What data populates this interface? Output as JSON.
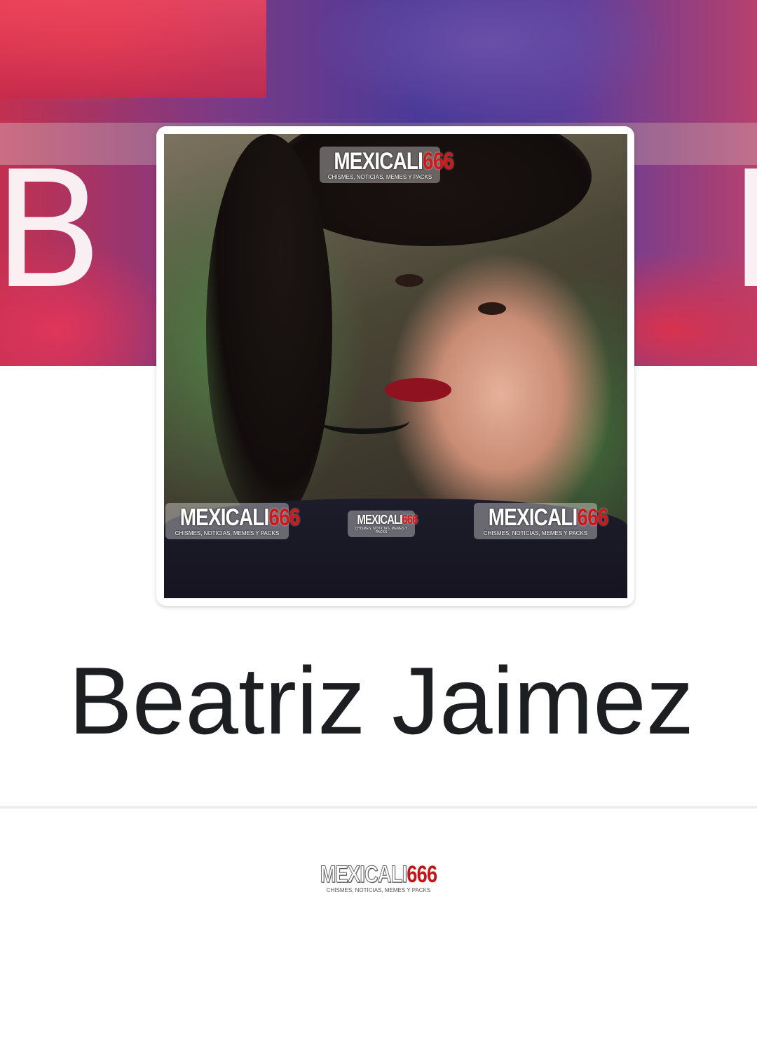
{
  "cover": {
    "letters_left": "BA",
    "letters_right": "I"
  },
  "profile": {
    "name": "Beatriz Jaimez"
  },
  "watermark": {
    "brand_word": "MEXICALI",
    "brand_number": "666",
    "tagline": "CHISMES, NOTICIAS, MEMES Y PACKS"
  },
  "footer_logo": {
    "brand_word": "MEXICALI",
    "brand_number": "666",
    "tagline": "CHISMES, NOTICIAS, MEMES Y PACKS"
  },
  "colors": {
    "brand_red": "#d01818",
    "name_text": "#1c1e21",
    "divider": "#eceef1"
  }
}
